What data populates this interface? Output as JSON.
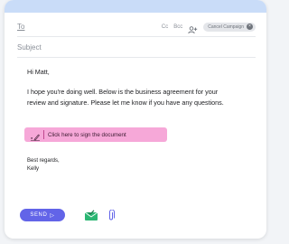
{
  "compose": {
    "to_label": "To",
    "cc_label": "Cc",
    "bcc_label": "Bcc",
    "campaign_chip": "Cancel Campaign",
    "subject_placeholder": "Subject"
  },
  "body": {
    "greeting": "Hi Matt,",
    "paragraph": "I hope you're doing well. Below is the business agreement for your review and signature. Please let me know if you have any questions.",
    "sign_cta": "Click here to sign the document",
    "closing": "Best regards,",
    "signature_name": "Kelly"
  },
  "footer": {
    "send_label": "SEND",
    "send_icon": "arrow-right-icon",
    "sign_icon": "envelope-check-icon",
    "attach_icon": "paperclip-icon"
  },
  "colors": {
    "accent": "#6264e8",
    "sign_highlight": "#f6a8d8",
    "header_strip": "#c9dcf8",
    "envelope_green": "#2bb673"
  }
}
